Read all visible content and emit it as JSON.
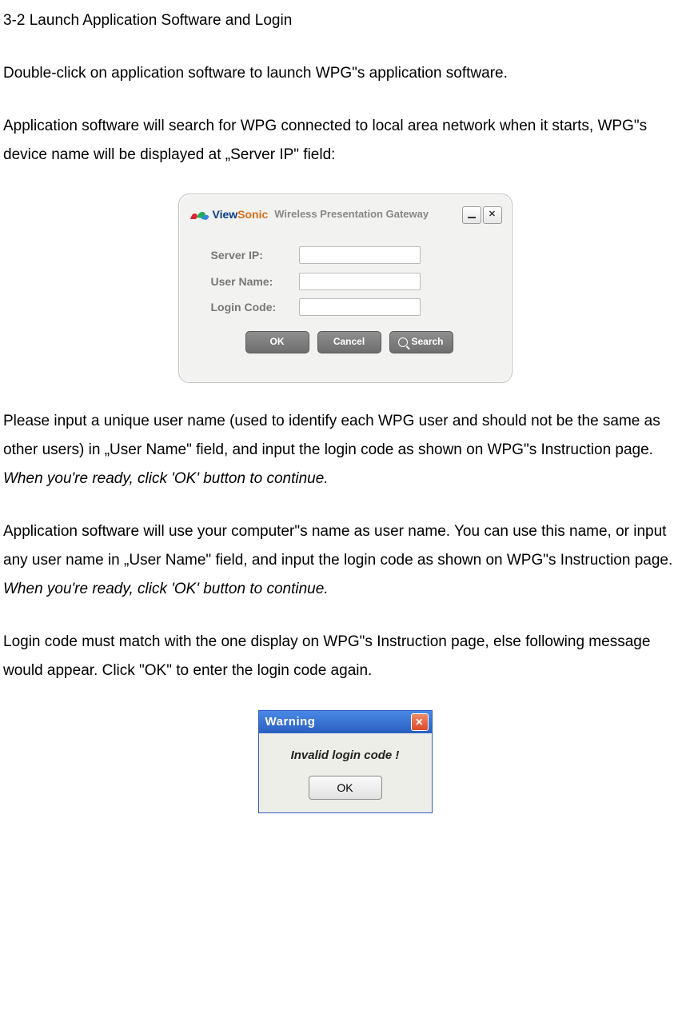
{
  "heading": "3-2 Launch Application Software and Login",
  "para1": "Double-click on application software to launch WPG\"s application software.",
  "para2": "Application software will search for WPG connected to local area network when it starts, WPG\"s device name will be displayed at „Server IP\" field:",
  "login": {
    "brand_view": "View",
    "brand_sonic": "Sonic",
    "brand_sub": "Wireless Presentation Gateway",
    "labels": {
      "server_ip": "Server IP:",
      "user_name": "User Name:",
      "login_code": "Login Code:"
    },
    "buttons": {
      "ok": "OK",
      "cancel": "Cancel",
      "search": "Search"
    }
  },
  "para3a": "Please input a unique user name (used to identify each WPG user and should not be the same as other users) in „User Name\" field, and input the login code as shown on WPG\"s Instruction page. ",
  "para3b": "When you're ready, click 'OK' button to continue.",
  "para4a": "Application software will use your computer\"s name as user name. You can use this name, or input any user name in „User Name\" field, and input the login code as shown on WPG\"s Instruction page. ",
  "para4b": "When you're ready, click 'OK' button to continue.",
  "para5": "Login code must match with the one display on WPG\"s Instruction page, else following message would appear. Click \"OK\" to enter the login code again.",
  "warning": {
    "title": "Warning",
    "message": "Invalid login code !",
    "ok": "OK"
  }
}
